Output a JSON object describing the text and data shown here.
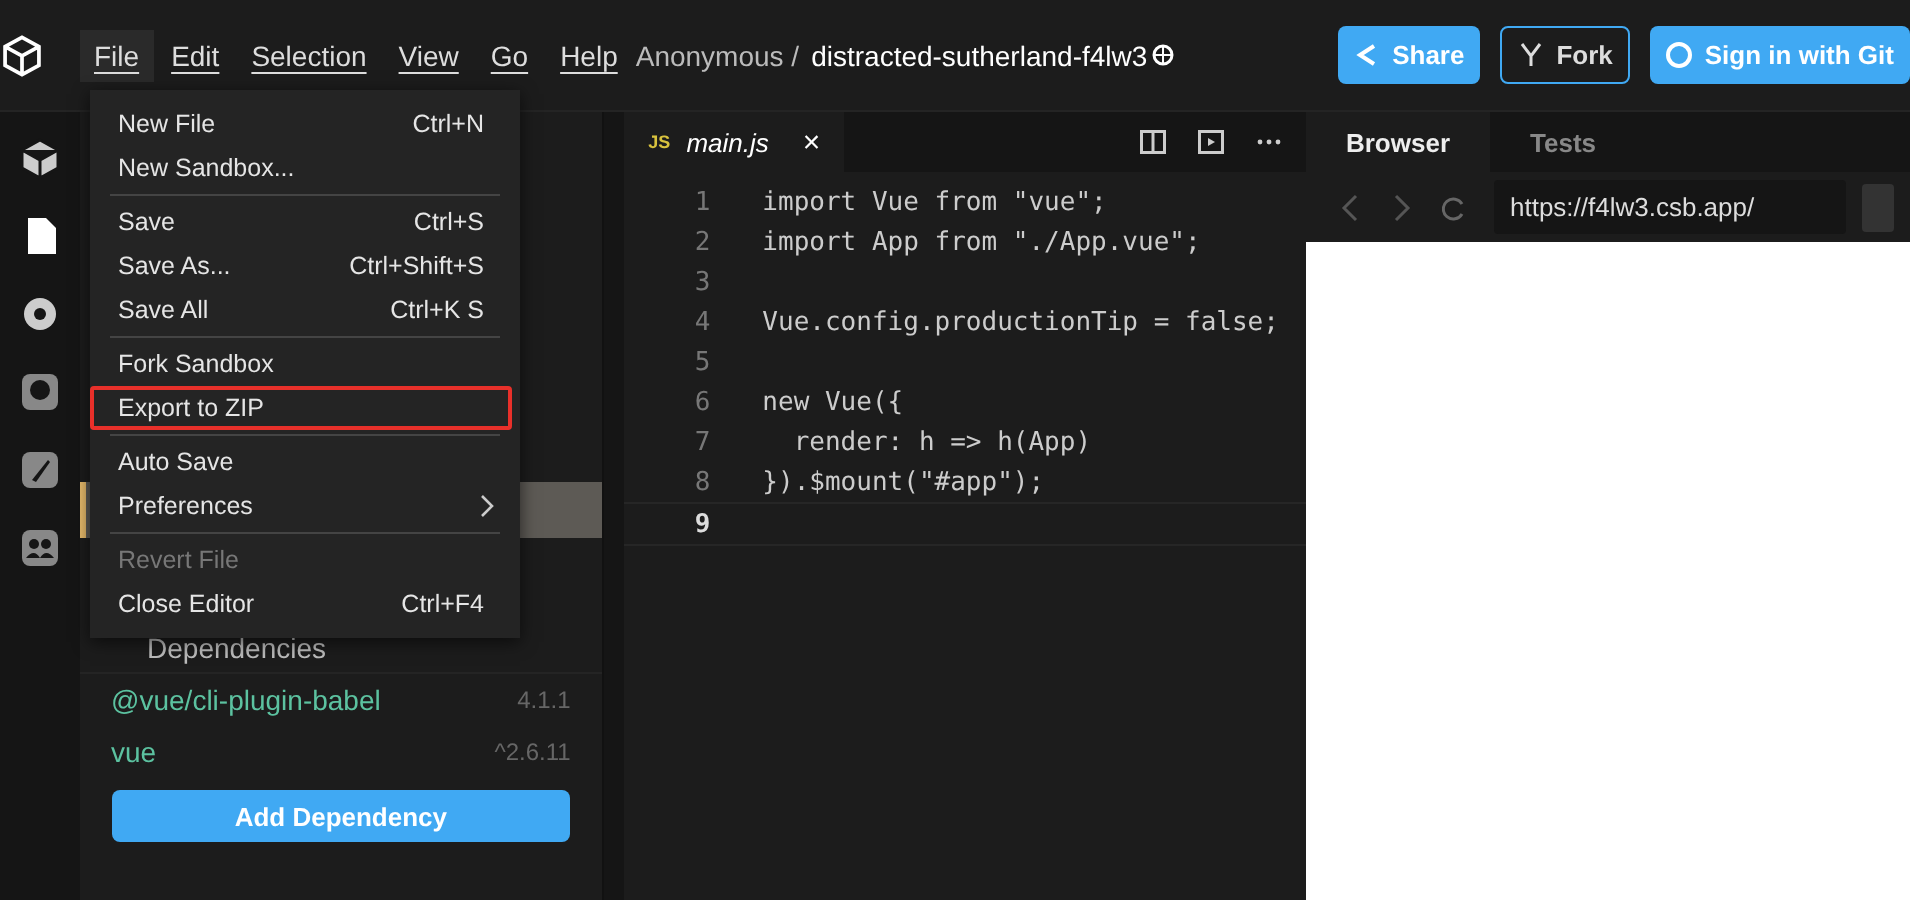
{
  "menubar": [
    {
      "label": "File",
      "selected": true
    },
    {
      "label": "Edit",
      "selected": false
    },
    {
      "label": "Selection",
      "selected": false
    },
    {
      "label": "View",
      "selected": false
    },
    {
      "label": "Go",
      "selected": false
    },
    {
      "label": "Help",
      "selected": false
    }
  ],
  "header": {
    "owner": "Anonymous /",
    "sandbox": "distracted-sutherland-f4lw3"
  },
  "buttons": [
    {
      "label": "Share",
      "kind": "share"
    },
    {
      "label": "Fork",
      "kind": "fork"
    },
    {
      "label": "Sign in with Git",
      "kind": "signin"
    }
  ],
  "file_menu": [
    [
      {
        "label": "New File",
        "shortcut": "Ctrl+N",
        "disabled": false,
        "highlighted": false,
        "submenu": false
      },
      {
        "label": "New Sandbox...",
        "disabled": false,
        "highlighted": false,
        "submenu": false
      }
    ],
    [
      {
        "label": "Save",
        "shortcut": "Ctrl+S",
        "disabled": false,
        "highlighted": false,
        "submenu": false
      },
      {
        "label": "Save As...",
        "shortcut": "Ctrl+Shift+S",
        "disabled": false,
        "highlighted": false,
        "submenu": false
      },
      {
        "label": "Save All",
        "shortcut": "Ctrl+K S",
        "disabled": false,
        "highlighted": false,
        "submenu": false
      }
    ],
    [
      {
        "label": "Fork Sandbox",
        "disabled": false,
        "highlighted": false,
        "submenu": false
      },
      {
        "label": "Export to ZIP",
        "disabled": false,
        "highlighted": true,
        "submenu": false
      }
    ],
    [
      {
        "label": "Auto Save",
        "disabled": false,
        "highlighted": false,
        "submenu": false
      },
      {
        "label": "Preferences",
        "disabled": false,
        "highlighted": false,
        "submenu": true
      }
    ],
    [
      {
        "label": "Revert File",
        "disabled": true,
        "highlighted": false,
        "submenu": false
      },
      {
        "label": "Close Editor",
        "shortcut": "Ctrl+F4",
        "disabled": false,
        "highlighted": false,
        "submenu": false
      }
    ]
  ],
  "sidebar": {
    "section": "Dependencies",
    "dependencies": [
      {
        "name": "@vue/cli-plugin-babel",
        "version": "4.1.1"
      },
      {
        "name": "vue",
        "version": "^2.6.11"
      }
    ],
    "add_button": "Add Dependency"
  },
  "editor": {
    "tab": {
      "badge": "JS",
      "label": "main.js",
      "close": "×"
    },
    "lines": [
      {
        "number": "1",
        "code": "import Vue from \"vue\";",
        "current": false
      },
      {
        "number": "2",
        "code": "import App from \"./App.vue\";",
        "current": false
      },
      {
        "number": "3",
        "current": false
      },
      {
        "number": "4",
        "code": "Vue.config.productionTip = false;",
        "current": false
      },
      {
        "number": "5",
        "current": false
      },
      {
        "number": "6",
        "code": "new Vue({",
        "current": false
      },
      {
        "number": "7",
        "code": "  render: h => h(App)",
        "current": false
      },
      {
        "number": "8",
        "code": "}).$mount(\"#app\");",
        "current": false
      },
      {
        "number": "9",
        "current": true
      }
    ]
  },
  "preview": {
    "tabs": [
      {
        "label": "Browser",
        "selected": true
      },
      {
        "label": "Tests",
        "selected": false
      }
    ],
    "url": "https://f4lw3.csb.app/"
  }
}
